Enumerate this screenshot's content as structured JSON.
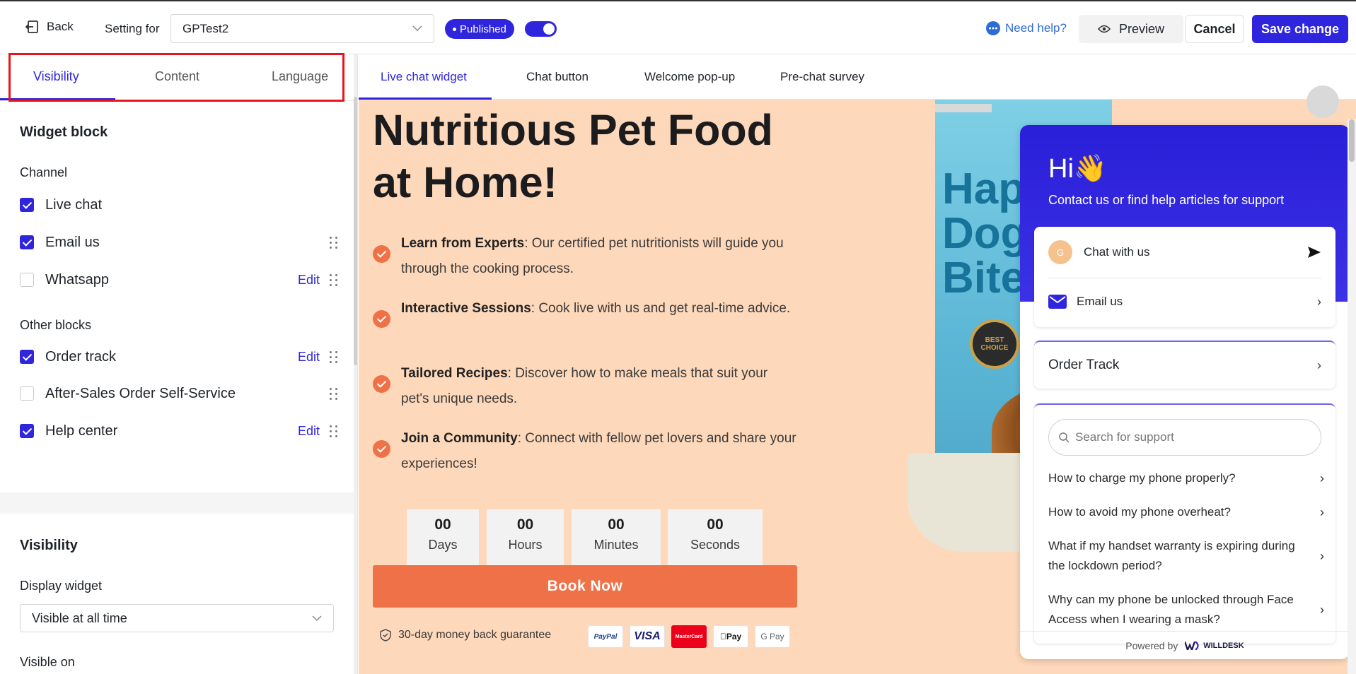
{
  "topbar": {
    "back_label": "Back",
    "setting_label": "Setting for",
    "setting_value": "GPTest2",
    "published_label": "Published",
    "need_help": "Need help?",
    "preview": "Preview",
    "cancel": "Cancel",
    "save": "Save change"
  },
  "left_tabs": [
    "Visibility",
    "Content",
    "Language"
  ],
  "widget_block": {
    "title": "Widget block",
    "channel_title": "Channel",
    "channel_items": [
      {
        "label": "Live chat",
        "checked": true,
        "edit": "",
        "grip": false
      },
      {
        "label": "Email us",
        "checked": true,
        "edit": "",
        "grip": true
      },
      {
        "label": "Whatsapp",
        "checked": false,
        "edit": "Edit",
        "grip": true
      }
    ],
    "other_title": "Other blocks",
    "other_items": [
      {
        "label": "Order track",
        "checked": true,
        "edit": "Edit",
        "grip": true
      },
      {
        "label": "After-Sales Order Self-Service",
        "checked": false,
        "edit": "",
        "grip": true
      },
      {
        "label": "Help center",
        "checked": true,
        "edit": "Edit",
        "grip": true
      }
    ]
  },
  "visibility": {
    "title": "Visibility",
    "display_label": "Display widget",
    "display_value": "Visible at all time",
    "visible_on": "Visible on"
  },
  "right_tabs": [
    "Live chat widget",
    "Chat button",
    "Welcome pop-up",
    "Pre-chat survey"
  ],
  "page": {
    "title_line1": "Nutritious Pet Food",
    "title_line2": "at Home!",
    "features": [
      {
        "bold": "Learn from Experts",
        "text": ": Our certified pet nutritionists will guide you through the cooking process."
      },
      {
        "bold": "Interactive Sessions",
        "text": ": Cook live with us and get real-time advice."
      },
      {
        "bold": "Tailored Recipes",
        "text": ": Discover how to make meals that suit your pet's unique needs."
      },
      {
        "bold": "Join a Community",
        "text": ": Connect with fellow pet lovers and share your experiences!"
      }
    ],
    "countdown": [
      {
        "num": "00",
        "unit": "Days"
      },
      {
        "num": "00",
        "unit": "Hours"
      },
      {
        "num": "00",
        "unit": "Minutes"
      },
      {
        "num": "00",
        "unit": "Seconds"
      }
    ],
    "book_now": "Book Now",
    "guarantee": "30-day money back guarantee",
    "payments": [
      "PayPal",
      "VISA",
      "MasterCard",
      "Pay",
      "G Pay"
    ],
    "product_text": "Happy Dog Bites",
    "medal_text": "BEST CHOICE"
  },
  "chat": {
    "greeting": "Hi👋",
    "subtitle": "Contact us or find help articles for support",
    "avatar_letter": "G",
    "chat_with_us": "Chat with us",
    "email_us": "Email us",
    "order_track": "Order Track",
    "search_placeholder": "Search for support",
    "faqs": [
      "How to charge my phone properly?",
      "How to avoid my phone overheat?",
      "What if my handset warranty is expiring during the lockdown period?",
      "Why can my phone be unlocked through Face Access when I wearing a mask?"
    ],
    "powered_by": "Powered by",
    "brand": "WILLDESK"
  },
  "colors": {
    "accent": "#2f25dd",
    "orange": "#ee7148",
    "canvas": "#fed8ba",
    "highlight": "#e8141b"
  }
}
